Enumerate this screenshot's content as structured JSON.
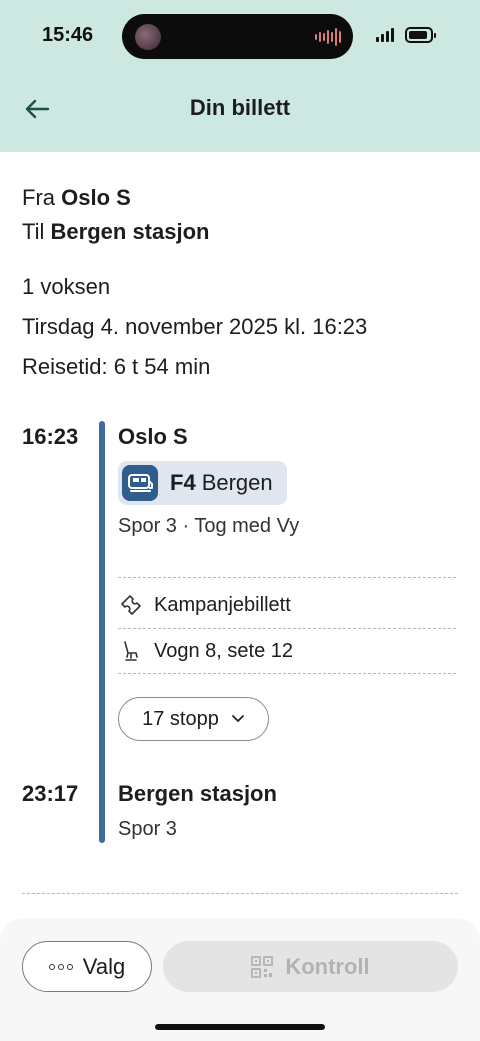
{
  "status_bar": {
    "time": "15:46"
  },
  "header": {
    "title": "Din billett",
    "back_icon": "arrow-left-icon"
  },
  "summary": {
    "from_prefix": "Fra",
    "from_station": "Oslo S",
    "to_prefix": "Til",
    "to_station": "Bergen stasjon",
    "passengers": "1 voksen",
    "departure": "Tirsdag 4. november 2025 kl. 16:23",
    "travel_time": "Reisetid: 6 t 54 min"
  },
  "itinerary": {
    "departure_time": "16:23",
    "departure_station": "Oslo S",
    "train_line": "F4",
    "train_destination": "Bergen",
    "departure_details": "Spor 3 · Tog med Vy",
    "ticket_type": "Kampanjebillett",
    "seat": "Vogn 8, sete 12",
    "stops_label": "17 stopp",
    "arrival_time": "23:17",
    "arrival_station": "Bergen stasjon",
    "arrival_platform": "Spor 3"
  },
  "actions": {
    "options_label": "Valg",
    "control_label": "Kontroll"
  },
  "colors": {
    "header_bg": "#cde8e1",
    "rail": "#3f6b9b",
    "train_icon_bg": "#2f5d8c",
    "chip_bg": "#dfe6f0"
  }
}
